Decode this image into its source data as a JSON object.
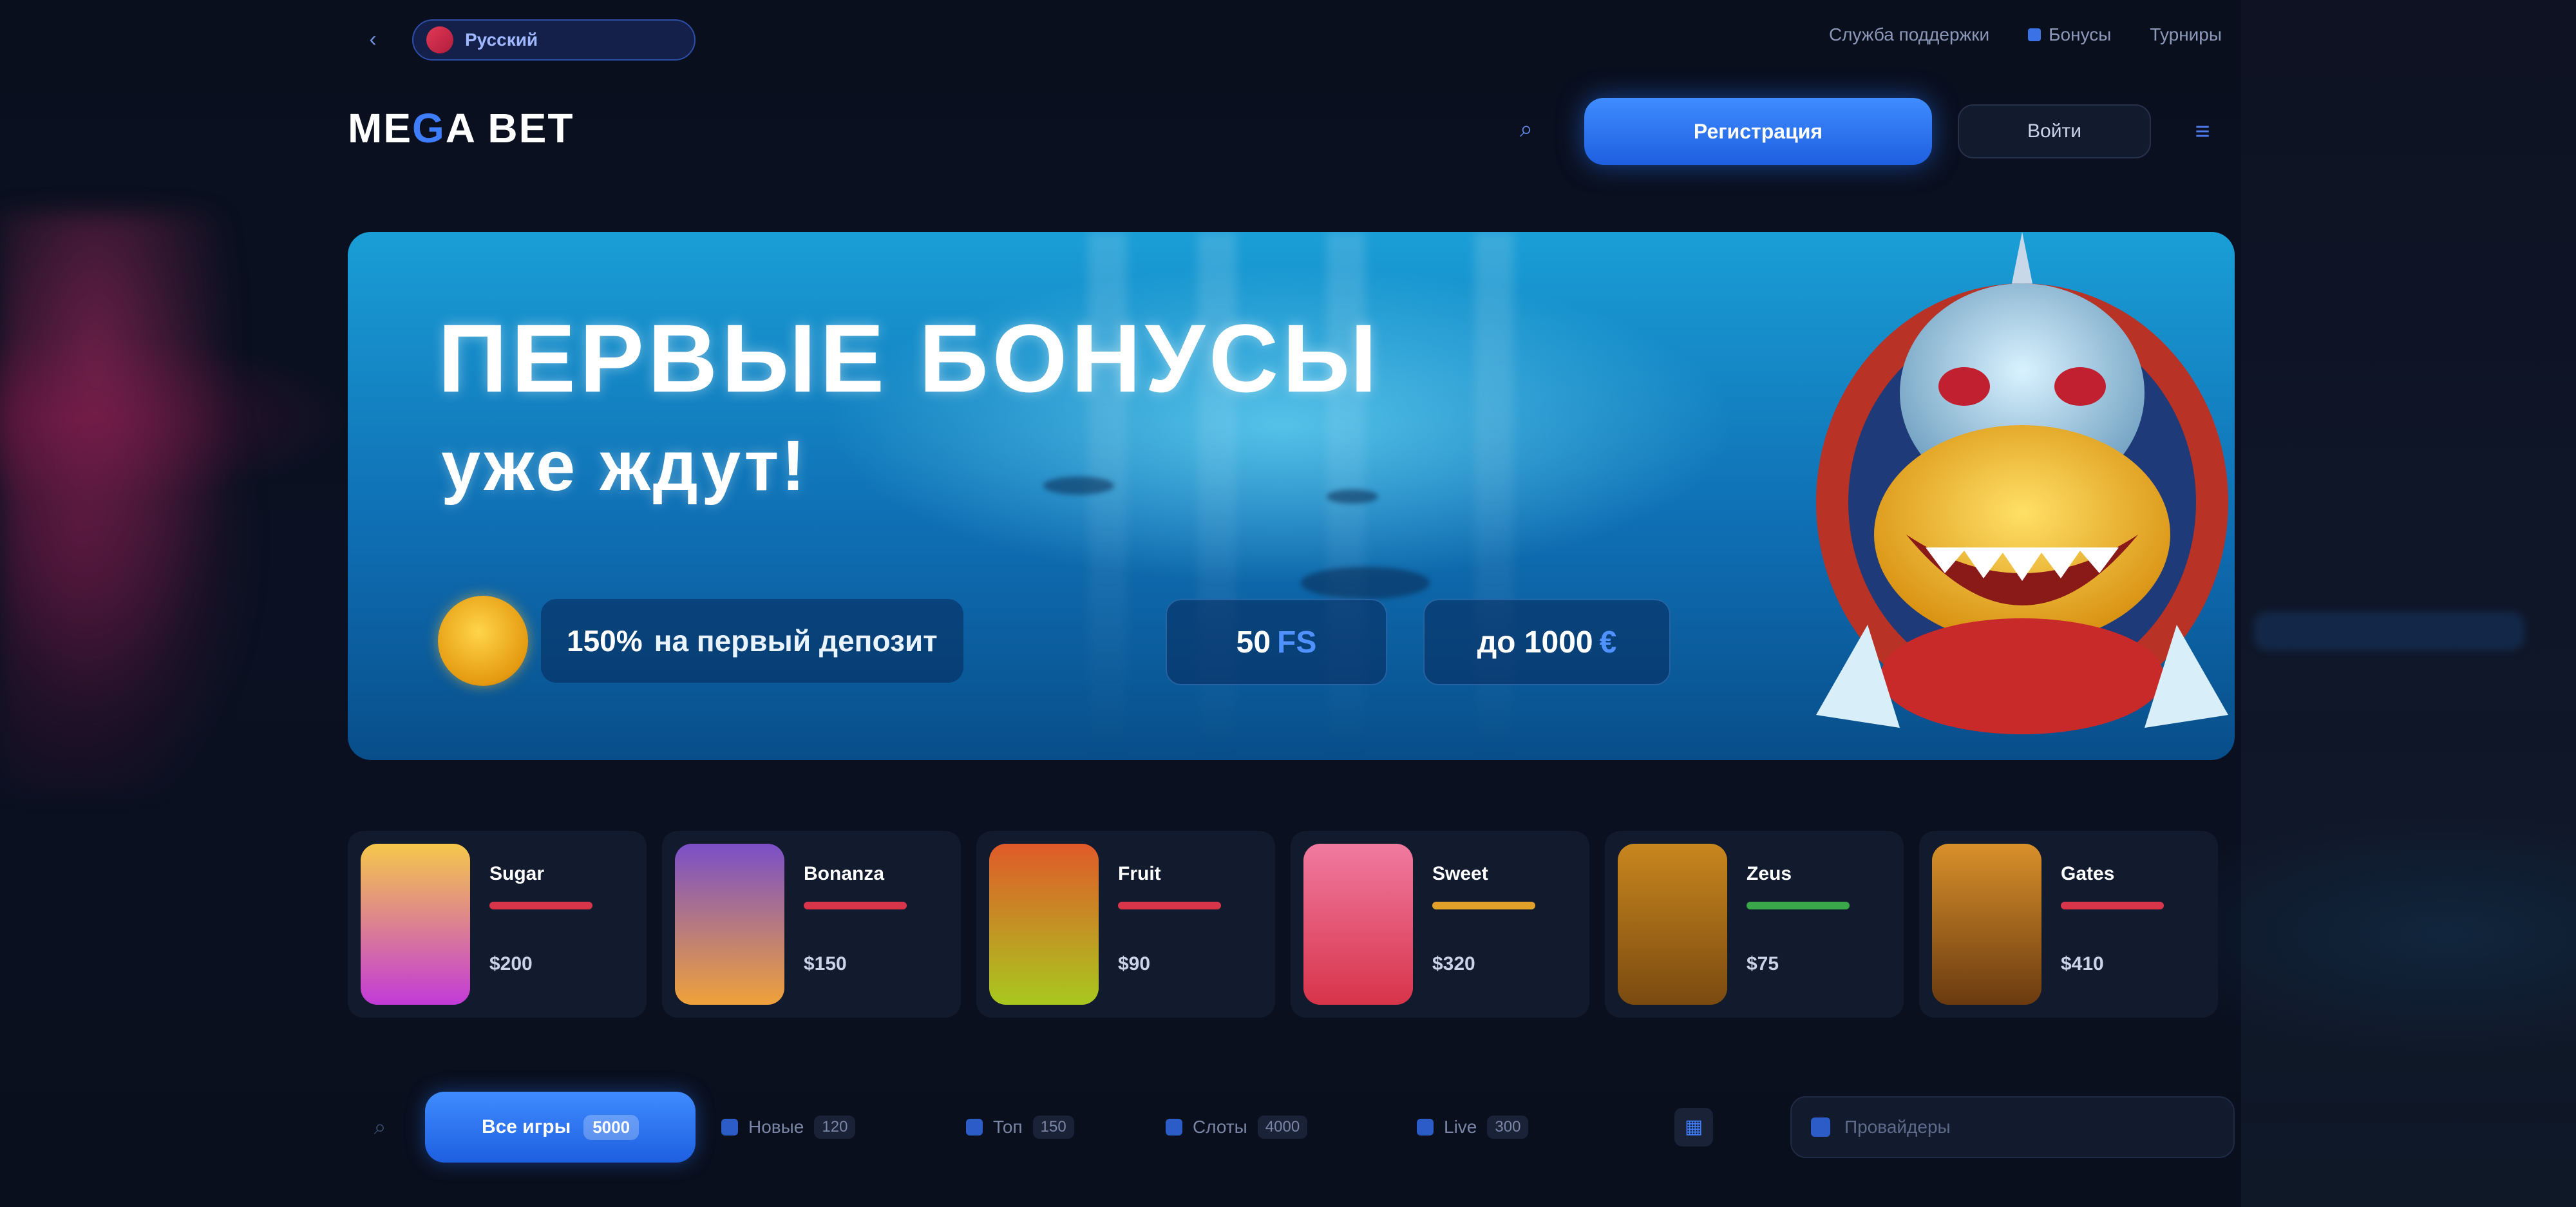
{
  "topbar": {
    "back_icon": "arrow-left-icon",
    "language_label": "Русский",
    "links": [
      {
        "label": "Служба поддержки",
        "icon": "support-icon"
      },
      {
        "label": "Бонусы",
        "icon": "gift-icon"
      },
      {
        "label": "Турниры",
        "icon": "trophy-icon"
      }
    ]
  },
  "header": {
    "logo_left": "ME",
    "logo_accent": "G",
    "logo_right": "A BET",
    "search_icon": "search-icon",
    "register_label": "Регистрация",
    "login_label": "Войти",
    "menu_icon": "menu-icon"
  },
  "banner": {
    "title": "ПЕРВЫЕ БОНУСЫ",
    "subtitle": "уже ждут!",
    "bonus_amount": "150%",
    "bonus_desc": "на первый депозит",
    "fs_value": "50",
    "fs_unit": "FS",
    "max_value": "до 1000",
    "max_unit": "€"
  },
  "games": [
    {
      "name": "Sugar",
      "amount": "$200",
      "thumb_colors": [
        "#f5c84a",
        "#c23ad8"
      ],
      "bar_color": "#d8344a"
    },
    {
      "name": "Bonanza",
      "amount": "$150",
      "thumb_colors": [
        "#7a4fc8",
        "#f0a23a"
      ],
      "bar_color": "#d8344a"
    },
    {
      "name": "Fruit",
      "amount": "$90",
      "thumb_colors": [
        "#e05a2a",
        "#a8c81e"
      ],
      "bar_color": "#d8344a"
    },
    {
      "name": "Sweet",
      "amount": "$320",
      "thumb_colors": [
        "#f07aa0",
        "#d8344a"
      ],
      "bar_color": "#e0a02a"
    },
    {
      "name": "Zeus",
      "amount": "$75",
      "thumb_colors": [
        "#c8861e",
        "#7a4a10"
      ],
      "bar_color": "#3aa84a"
    },
    {
      "name": "Gates",
      "amount": "$410",
      "thumb_colors": [
        "#d8902a",
        "#6a3a10"
      ],
      "bar_color": "#d8344a"
    }
  ],
  "filters": {
    "search_icon": "search-icon",
    "active_label": "Все игры",
    "active_count": "5000",
    "tabs": [
      {
        "label": "Новые",
        "count": "120"
      },
      {
        "label": "Топ",
        "count": "150"
      },
      {
        "label": "Слоты",
        "count": "4000"
      },
      {
        "label": "Live",
        "count": "300"
      }
    ],
    "provider_icon": "grid-icon",
    "provider_placeholder": "Провайдеры"
  },
  "colors": {
    "accent": "#3f7dff",
    "background": "#0b1020",
    "banner_top": "#1a9ed6",
    "banner_bottom": "#084e8a"
  }
}
